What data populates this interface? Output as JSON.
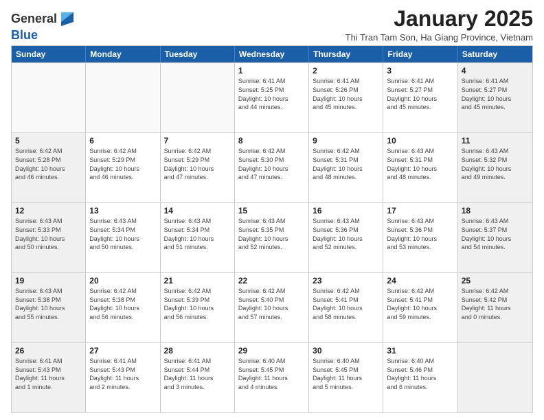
{
  "logo": {
    "line1": "General",
    "line2": "Blue"
  },
  "title": "January 2025",
  "subtitle": "Thi Tran Tam Son, Ha Giang Province, Vietnam",
  "headers": [
    "Sunday",
    "Monday",
    "Tuesday",
    "Wednesday",
    "Thursday",
    "Friday",
    "Saturday"
  ],
  "weeks": [
    [
      {
        "day": "",
        "info": "",
        "empty": true
      },
      {
        "day": "",
        "info": "",
        "empty": true
      },
      {
        "day": "",
        "info": "",
        "empty": true
      },
      {
        "day": "1",
        "info": "Sunrise: 6:41 AM\nSunset: 5:25 PM\nDaylight: 10 hours\nand 44 minutes."
      },
      {
        "day": "2",
        "info": "Sunrise: 6:41 AM\nSunset: 5:26 PM\nDaylight: 10 hours\nand 45 minutes."
      },
      {
        "day": "3",
        "info": "Sunrise: 6:41 AM\nSunset: 5:27 PM\nDaylight: 10 hours\nand 45 minutes."
      },
      {
        "day": "4",
        "info": "Sunrise: 6:41 AM\nSunset: 5:27 PM\nDaylight: 10 hours\nand 45 minutes.",
        "shaded": true
      }
    ],
    [
      {
        "day": "5",
        "info": "Sunrise: 6:42 AM\nSunset: 5:28 PM\nDaylight: 10 hours\nand 46 minutes.",
        "shaded": true
      },
      {
        "day": "6",
        "info": "Sunrise: 6:42 AM\nSunset: 5:29 PM\nDaylight: 10 hours\nand 46 minutes."
      },
      {
        "day": "7",
        "info": "Sunrise: 6:42 AM\nSunset: 5:29 PM\nDaylight: 10 hours\nand 47 minutes."
      },
      {
        "day": "8",
        "info": "Sunrise: 6:42 AM\nSunset: 5:30 PM\nDaylight: 10 hours\nand 47 minutes."
      },
      {
        "day": "9",
        "info": "Sunrise: 6:42 AM\nSunset: 5:31 PM\nDaylight: 10 hours\nand 48 minutes."
      },
      {
        "day": "10",
        "info": "Sunrise: 6:43 AM\nSunset: 5:31 PM\nDaylight: 10 hours\nand 48 minutes."
      },
      {
        "day": "11",
        "info": "Sunrise: 6:43 AM\nSunset: 5:32 PM\nDaylight: 10 hours\nand 49 minutes.",
        "shaded": true
      }
    ],
    [
      {
        "day": "12",
        "info": "Sunrise: 6:43 AM\nSunset: 5:33 PM\nDaylight: 10 hours\nand 50 minutes.",
        "shaded": true
      },
      {
        "day": "13",
        "info": "Sunrise: 6:43 AM\nSunset: 5:34 PM\nDaylight: 10 hours\nand 50 minutes."
      },
      {
        "day": "14",
        "info": "Sunrise: 6:43 AM\nSunset: 5:34 PM\nDaylight: 10 hours\nand 51 minutes."
      },
      {
        "day": "15",
        "info": "Sunrise: 6:43 AM\nSunset: 5:35 PM\nDaylight: 10 hours\nand 52 minutes."
      },
      {
        "day": "16",
        "info": "Sunrise: 6:43 AM\nSunset: 5:36 PM\nDaylight: 10 hours\nand 52 minutes."
      },
      {
        "day": "17",
        "info": "Sunrise: 6:43 AM\nSunset: 5:36 PM\nDaylight: 10 hours\nand 53 minutes."
      },
      {
        "day": "18",
        "info": "Sunrise: 6:43 AM\nSunset: 5:37 PM\nDaylight: 10 hours\nand 54 minutes.",
        "shaded": true
      }
    ],
    [
      {
        "day": "19",
        "info": "Sunrise: 6:43 AM\nSunset: 5:38 PM\nDaylight: 10 hours\nand 55 minutes.",
        "shaded": true
      },
      {
        "day": "20",
        "info": "Sunrise: 6:42 AM\nSunset: 5:38 PM\nDaylight: 10 hours\nand 56 minutes."
      },
      {
        "day": "21",
        "info": "Sunrise: 6:42 AM\nSunset: 5:39 PM\nDaylight: 10 hours\nand 56 minutes."
      },
      {
        "day": "22",
        "info": "Sunrise: 6:42 AM\nSunset: 5:40 PM\nDaylight: 10 hours\nand 57 minutes."
      },
      {
        "day": "23",
        "info": "Sunrise: 6:42 AM\nSunset: 5:41 PM\nDaylight: 10 hours\nand 58 minutes."
      },
      {
        "day": "24",
        "info": "Sunrise: 6:42 AM\nSunset: 5:41 PM\nDaylight: 10 hours\nand 59 minutes."
      },
      {
        "day": "25",
        "info": "Sunrise: 6:42 AM\nSunset: 5:42 PM\nDaylight: 11 hours\nand 0 minutes.",
        "shaded": true
      }
    ],
    [
      {
        "day": "26",
        "info": "Sunrise: 6:41 AM\nSunset: 5:43 PM\nDaylight: 11 hours\nand 1 minute.",
        "shaded": true
      },
      {
        "day": "27",
        "info": "Sunrise: 6:41 AM\nSunset: 5:43 PM\nDaylight: 11 hours\nand 2 minutes."
      },
      {
        "day": "28",
        "info": "Sunrise: 6:41 AM\nSunset: 5:44 PM\nDaylight: 11 hours\nand 3 minutes."
      },
      {
        "day": "29",
        "info": "Sunrise: 6:40 AM\nSunset: 5:45 PM\nDaylight: 11 hours\nand 4 minutes."
      },
      {
        "day": "30",
        "info": "Sunrise: 6:40 AM\nSunset: 5:45 PM\nDaylight: 11 hours\nand 5 minutes."
      },
      {
        "day": "31",
        "info": "Sunrise: 6:40 AM\nSunset: 5:46 PM\nDaylight: 11 hours\nand 6 minutes."
      },
      {
        "day": "",
        "info": "",
        "empty": true,
        "shaded": true
      }
    ]
  ]
}
